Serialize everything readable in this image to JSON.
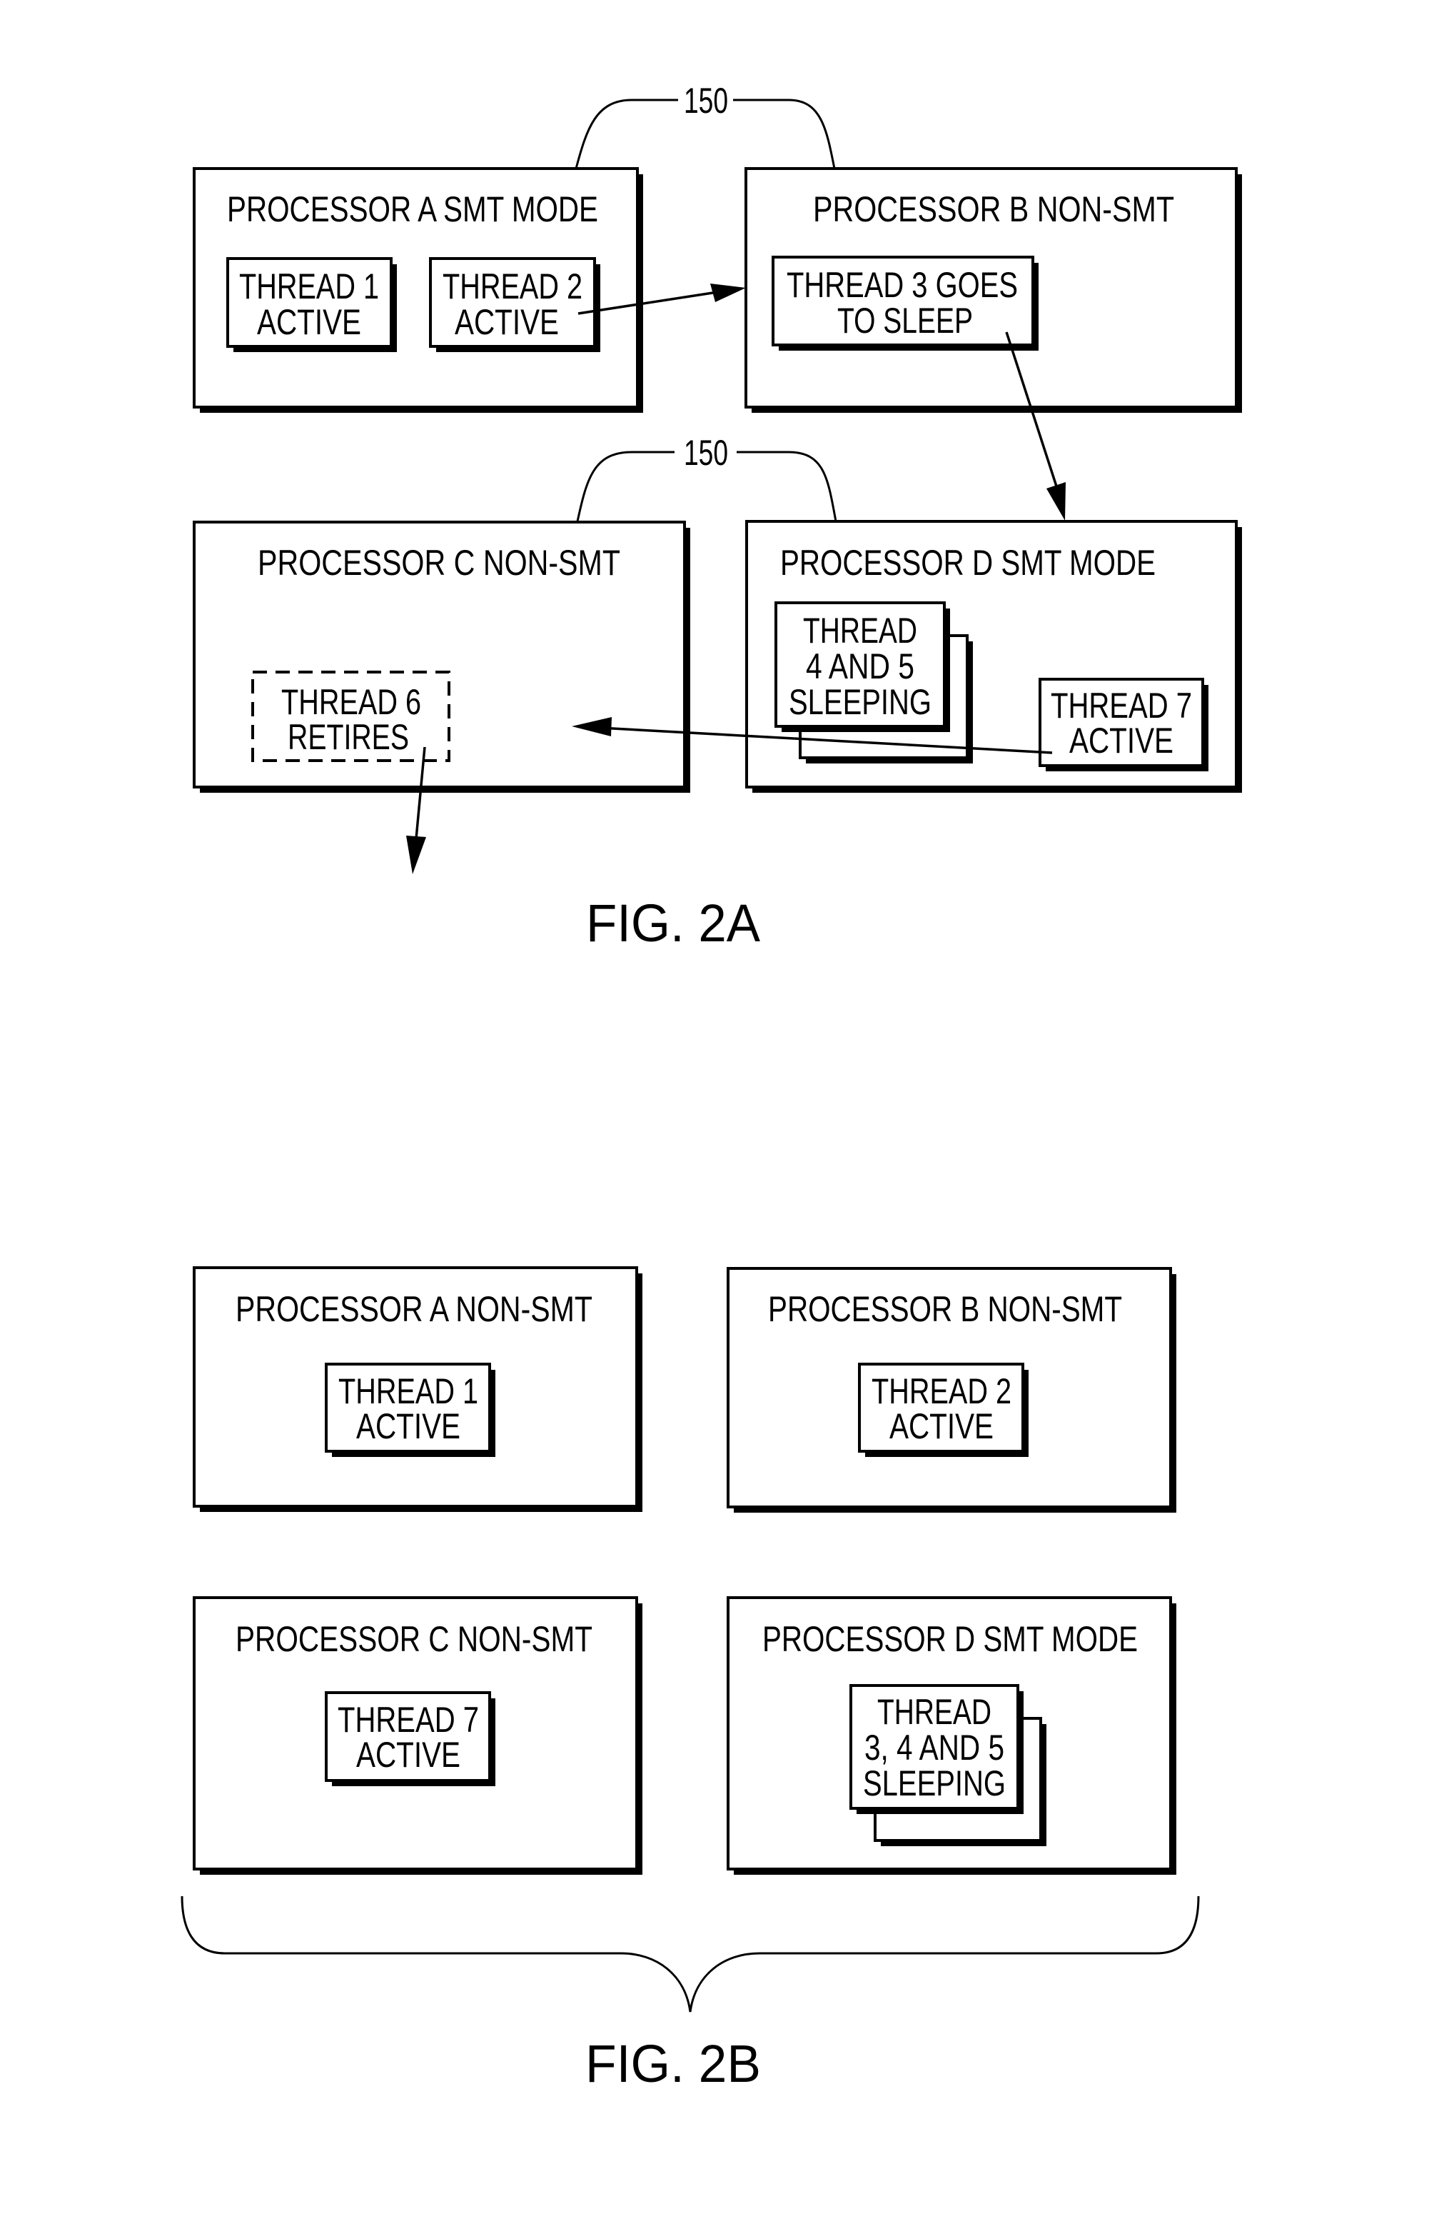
{
  "colors": {
    "ink": "#000000",
    "paper": "#ffffff"
  },
  "fig2a": {
    "caption": "FIG. 2A",
    "ref_label_top": "150",
    "ref_label_bottom": "150",
    "processors": {
      "a": {
        "title": "PROCESSOR A SMT MODE",
        "threads": [
          {
            "lines": [
              "THREAD 1",
              "ACTIVE"
            ],
            "state": "active"
          },
          {
            "lines": [
              "THREAD 2",
              "ACTIVE"
            ],
            "state": "active"
          }
        ]
      },
      "b": {
        "title": "PROCESSOR B  NON-SMT",
        "threads": [
          {
            "lines": [
              "THREAD 3 GOES",
              "TO SLEEP"
            ],
            "state": "going-to-sleep"
          }
        ]
      },
      "c": {
        "title": "PROCESSOR C  NON-SMT",
        "threads": [
          {
            "lines": [
              "THREAD 6",
              "RETIRES"
            ],
            "state": "retiring"
          }
        ]
      },
      "d": {
        "title": "PROCESSOR D SMT MODE",
        "threads": [
          {
            "lines": [
              "THREAD",
              "4 AND 5",
              "SLEEPING"
            ],
            "state": "sleeping",
            "stacked": true
          },
          {
            "lines": [
              "THREAD 7",
              "ACTIVE"
            ],
            "state": "active"
          }
        ]
      }
    },
    "arrows": [
      {
        "from": "thread-2",
        "to": "processor-b"
      },
      {
        "from": "thread-3",
        "to": "processor-d"
      },
      {
        "from": "thread-7",
        "to": "processor-c"
      },
      {
        "from": "thread-6",
        "to": "out"
      }
    ]
  },
  "fig2b": {
    "caption": "FIG. 2B",
    "processors": {
      "a": {
        "title": "PROCESSOR A NON-SMT",
        "threads": [
          {
            "lines": [
              "THREAD 1",
              "ACTIVE"
            ]
          }
        ]
      },
      "b": {
        "title": "PROCESSOR B NON-SMT",
        "threads": [
          {
            "lines": [
              "THREAD 2",
              "ACTIVE"
            ]
          }
        ]
      },
      "c": {
        "title": "PROCESSOR C NON-SMT",
        "threads": [
          {
            "lines": [
              "THREAD 7",
              "ACTIVE"
            ]
          }
        ]
      },
      "d": {
        "title": "PROCESSOR D SMT MODE",
        "threads": [
          {
            "lines": [
              "THREAD",
              "3, 4 AND 5",
              "SLEEPING"
            ],
            "stacked": true
          }
        ]
      }
    }
  }
}
